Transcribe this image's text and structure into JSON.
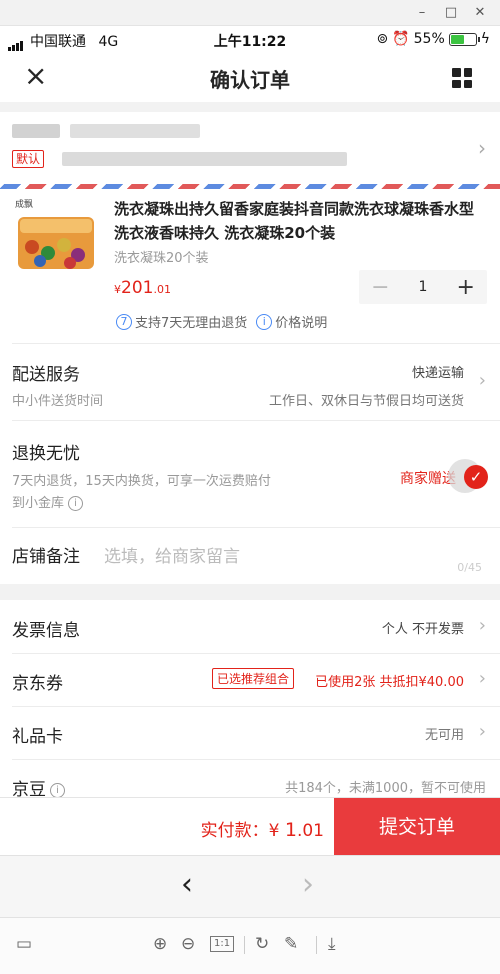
{
  "window": {
    "minimize": "–",
    "maximize": "□",
    "close": "✕"
  },
  "status_bar": {
    "carrier": "中国联通",
    "network": "4G",
    "time": "上午11:22",
    "battery": "55%",
    "battery_level": 0.55
  },
  "header": {
    "title": "确认订单"
  },
  "address": {
    "default_tag": "默认"
  },
  "product": {
    "name": "洗衣凝珠出持久留香家庭装抖音同款洗衣球凝珠香水型洗衣液香味持久 洗衣凝珠20个装",
    "spec": "洗衣凝珠20个装",
    "price_symbol": "¥",
    "price_main": "201",
    "price_cents": ".01",
    "quantity": "1",
    "minus": "−",
    "plus": "+",
    "return_badge": "7",
    "return_text": "支持7天无理由退货",
    "price_info_icon": "i",
    "price_info_text": "价格说明",
    "image_brand_text": "成飘"
  },
  "delivery": {
    "label": "配送服务",
    "sub": "中小件送货时间",
    "method": "快递运输",
    "schedule": "工作日、双休日与节假日均可送货"
  },
  "return_worry": {
    "label": "退换无忧",
    "desc_line1": "7天内退货，15天内换货，可享一次运费赔付",
    "desc_line2": "到小金库",
    "gift_text": "商家赠送"
  },
  "remark": {
    "label": "店铺备注",
    "placeholder": "选填，给商家留言",
    "counter": "0/45"
  },
  "invoice": {
    "label": "发票信息",
    "value": "个人 不开发票"
  },
  "coupon": {
    "label": "京东券",
    "tag": "已选推荐组合",
    "value": "已使用2张 共抵扣¥40.00"
  },
  "giftcard": {
    "label": "礼品卡",
    "value": "无可用"
  },
  "jingdou": {
    "label": "京豆",
    "value": "共184个，未满1000，暂不可使用"
  },
  "footer": {
    "pay_label": "实付款：",
    "pay_symbol": "¥",
    "pay_main": "1",
    "pay_cents": ".01",
    "submit": "提交订单"
  },
  "browser": {
    "back": "‹",
    "forward": "›"
  },
  "colors": {
    "accent": "#e2231a",
    "submit_bg": "#e93b3d",
    "page_bg": "#f2f2f2"
  }
}
